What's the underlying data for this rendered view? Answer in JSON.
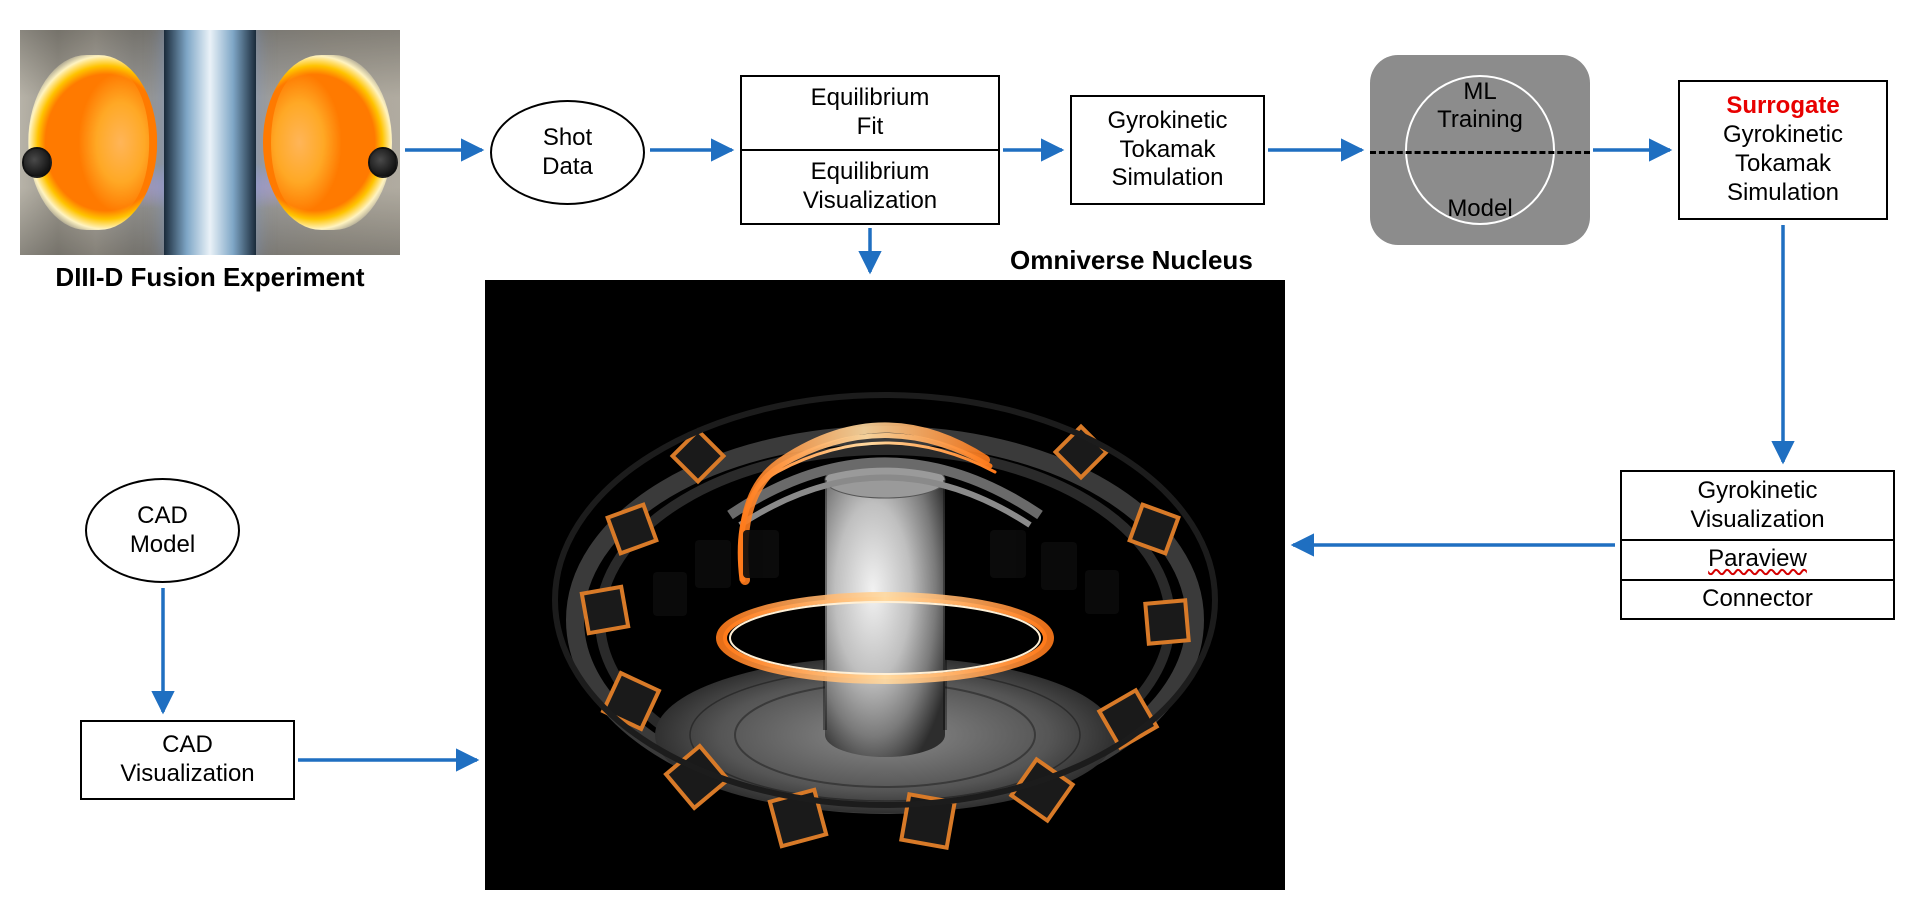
{
  "experiment_caption": "DIII-D Fusion Experiment",
  "shot_data": {
    "line1": "Shot",
    "line2": "Data"
  },
  "equilibrium": {
    "fit_line1": "Equilibrium",
    "fit_line2": "Fit",
    "viz_line1": "Equilibrium",
    "viz_line2": "Visualization"
  },
  "gyrokinetic_sim": {
    "line1": "Gyrokinetic",
    "line2": "Tokamak",
    "line3": "Simulation"
  },
  "ml": {
    "training_line1": "ML",
    "training_line2": "Training",
    "model": "Model"
  },
  "surrogate": {
    "tag": "Surrogate",
    "line1": "Gyrokinetic",
    "line2": "Tokamak",
    "line3": "Simulation"
  },
  "gyro_viz": {
    "line1": "Gyrokinetic",
    "line2": "Visualization",
    "paraview": "Paraview",
    "connector": "Connector"
  },
  "cad": {
    "model_line1": "CAD",
    "model_line2": "Model",
    "viz_line1": "CAD",
    "viz_line2": "Visualization"
  },
  "omniverse_title": "Omniverse Nucleus",
  "colors": {
    "arrow": "#1f6fc1",
    "accent_red": "#e80000"
  }
}
